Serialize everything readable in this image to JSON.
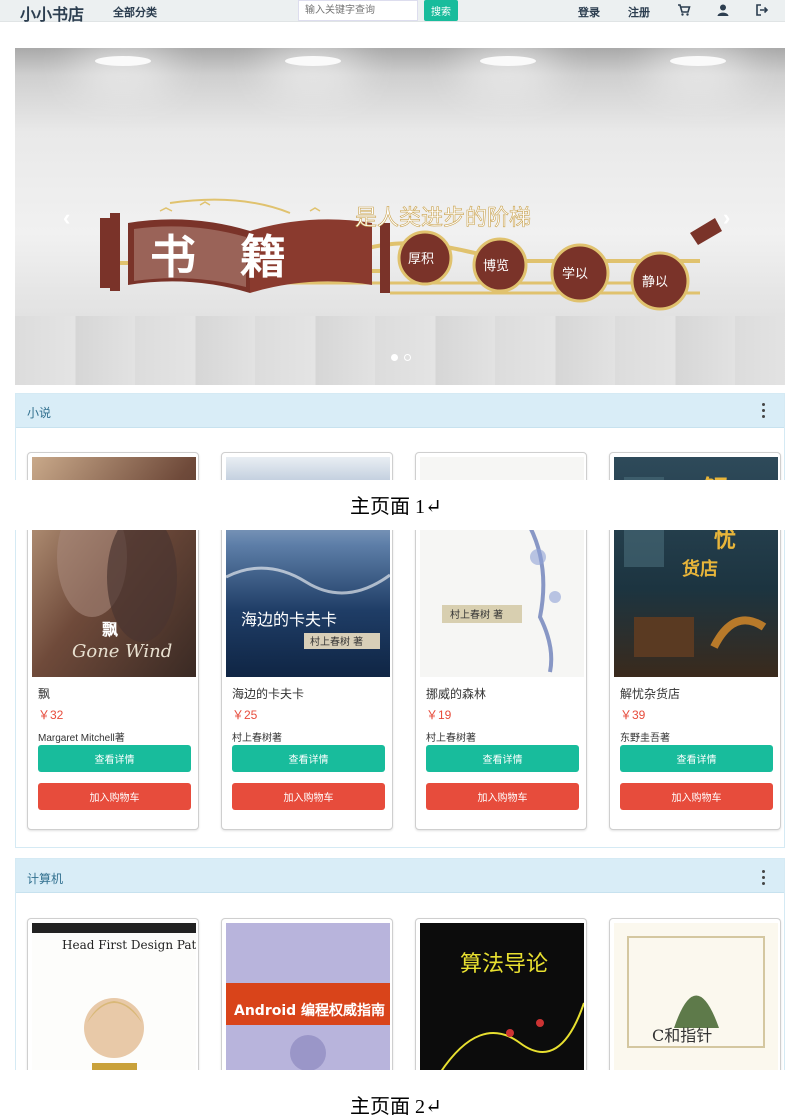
{
  "navbar": {
    "brand": "小小书店",
    "category": "全部分类",
    "search_placeholder": "输入关键字查询",
    "search_button": "搜索",
    "login": "登录",
    "register": "注册",
    "icons": [
      "cart-icon",
      "user-icon",
      "logout-icon"
    ]
  },
  "carousel": {
    "slide_count": 2,
    "active_slide": 1
  },
  "sections": [
    {
      "title": "小说"
    },
    {
      "title": "计算机"
    }
  ],
  "novels": [
    {
      "name": "飘",
      "price": "￥32",
      "author": "Margaret Mitchell著",
      "detail": "查看详情",
      "cart": "加入购物车"
    },
    {
      "name": "海边的卡夫卡",
      "price": "￥25",
      "author": "村上春树著",
      "detail": "查看详情",
      "cart": "加入购物车"
    },
    {
      "name": "挪威的森林",
      "price": "￥19",
      "author": "村上春树著",
      "detail": "查看详情",
      "cart": "加入购物车"
    },
    {
      "name": "解忧杂货店",
      "price": "￥39",
      "author": "东野圭吾著",
      "detail": "查看详情",
      "cart": "加入购物车"
    }
  ],
  "computer_books": [
    {
      "cover_title": "Head First Design Patterns"
    },
    {
      "cover_title": "Android 编程权威指南"
    },
    {
      "cover_title": "算法导论"
    },
    {
      "cover_title": "C和指针"
    }
  ],
  "captions": {
    "first": "主页面 1↵",
    "second": "主页面 2↵"
  },
  "colors": {
    "navbar_bg": "#ecf0f1",
    "primary": "#18bc9c",
    "danger": "#e74c3c",
    "panel_head": "#d9edf7"
  }
}
